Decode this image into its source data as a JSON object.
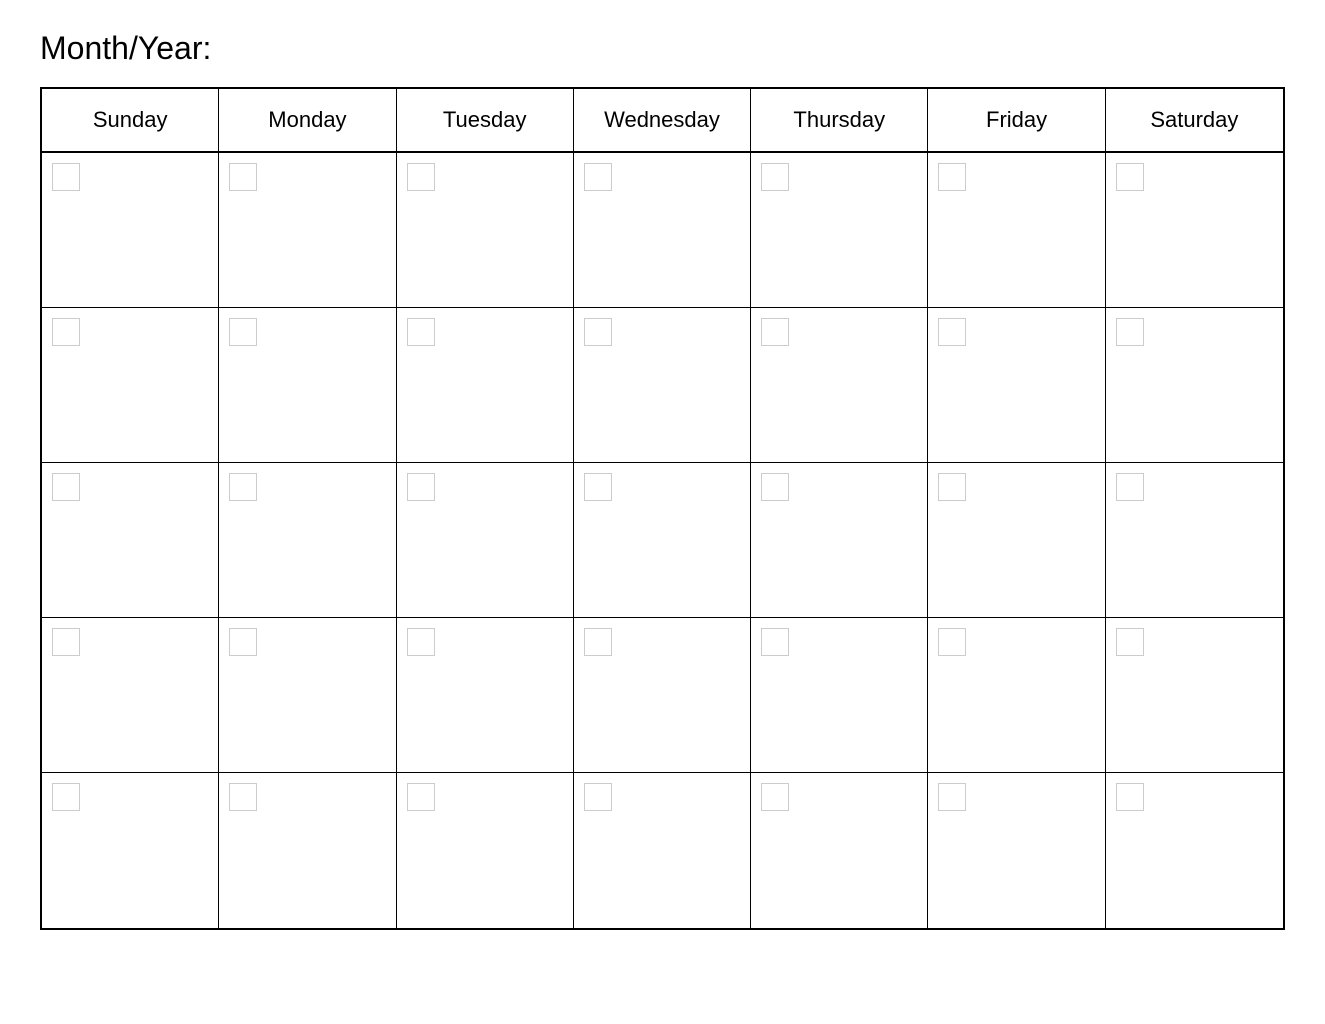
{
  "header": {
    "title": "Month/Year:"
  },
  "calendar": {
    "days": [
      {
        "label": "Sunday"
      },
      {
        "label": "Monday"
      },
      {
        "label": "Tuesday"
      },
      {
        "label": "Wednesday"
      },
      {
        "label": "Thursday"
      },
      {
        "label": "Friday"
      },
      {
        "label": "Saturday"
      }
    ],
    "rows": 5
  }
}
